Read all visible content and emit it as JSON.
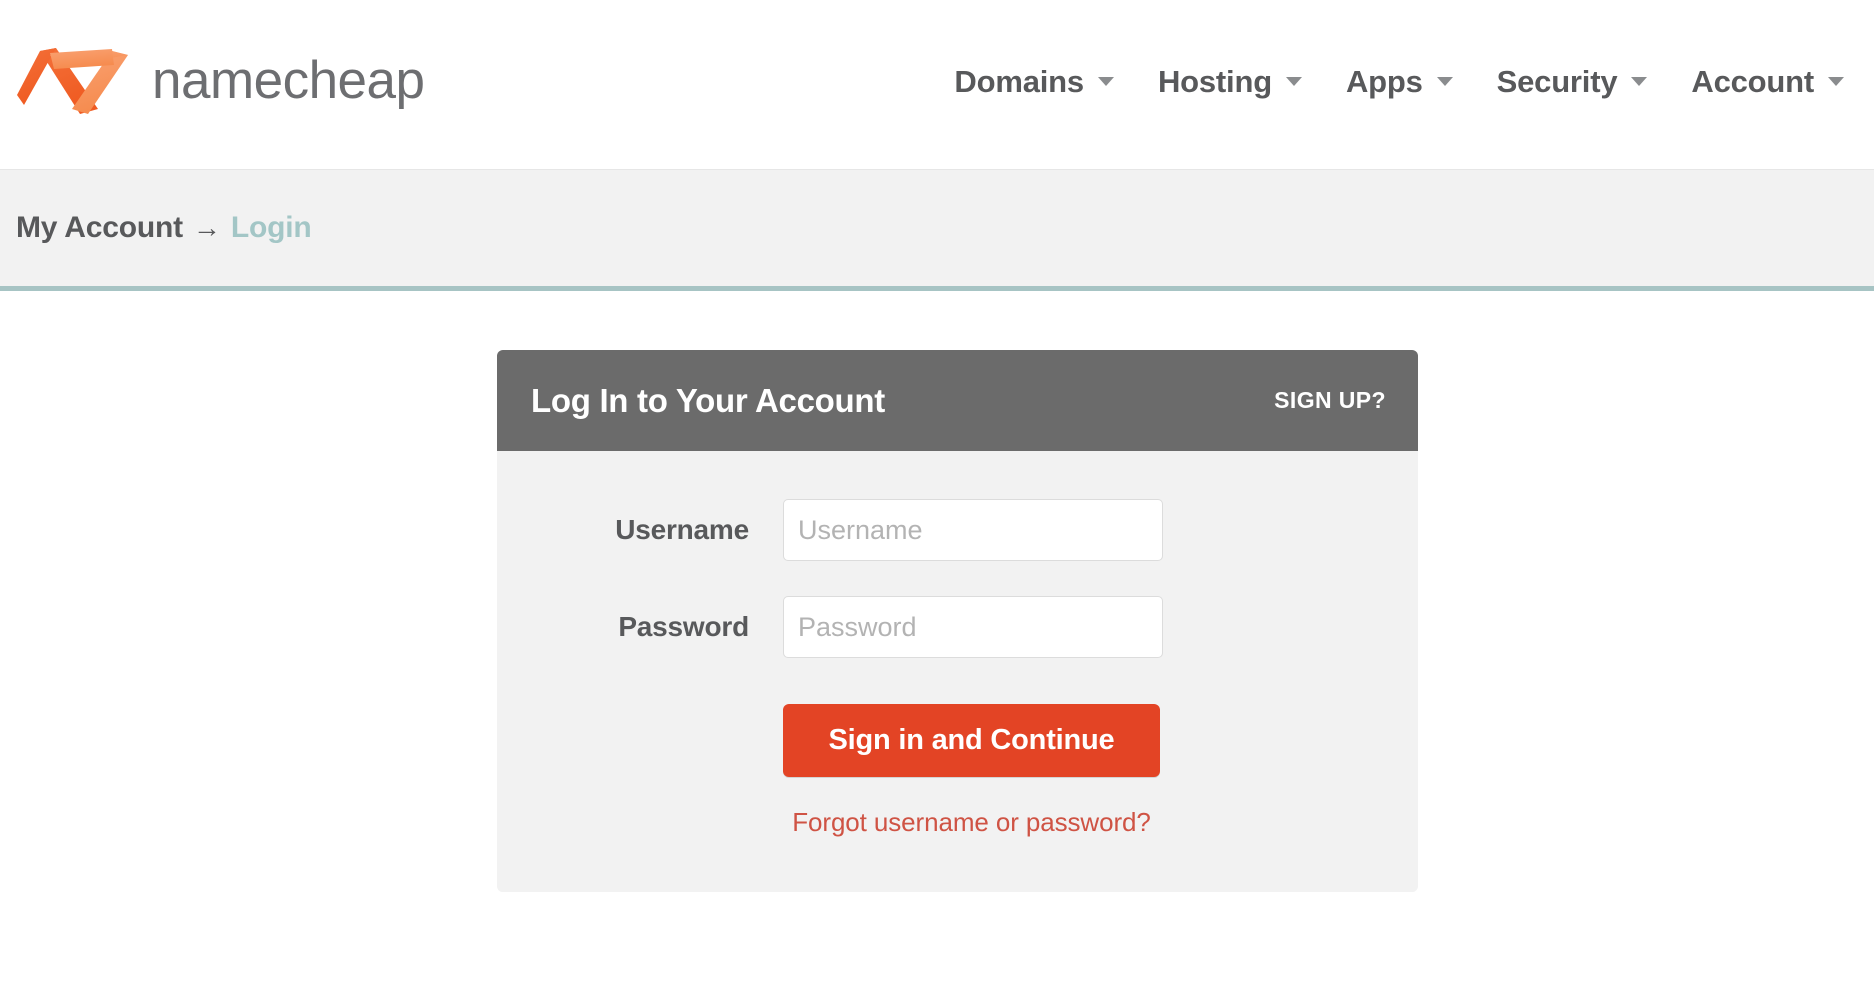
{
  "brand": {
    "name": "namecheap",
    "logo_icon": "namecheap-n-logo",
    "logo_color_dark": "#f05524",
    "logo_color_light": "#f7915b",
    "wordmark_color": "#6d6e71"
  },
  "nav": {
    "items": [
      {
        "label": "Domains",
        "icon": "chevron-down-icon"
      },
      {
        "label": "Hosting",
        "icon": "chevron-down-icon"
      },
      {
        "label": "Apps",
        "icon": "chevron-down-icon"
      },
      {
        "label": "Security",
        "icon": "chevron-down-icon"
      },
      {
        "label": "Account",
        "icon": "chevron-down-icon"
      }
    ]
  },
  "breadcrumb": {
    "root": "My Account",
    "separator": "→",
    "current": "Login",
    "current_color": "#a3c6c6",
    "rule_color": "#a7c4c4"
  },
  "login_card": {
    "title": "Log In to Your Account",
    "signup_label": "SIGN UP?",
    "header_bg": "#6b6b6b",
    "body_bg": "#f2f2f2",
    "fields": [
      {
        "label": "Username",
        "value": "",
        "placeholder": "Username",
        "type": "text"
      },
      {
        "label": "Password",
        "value": "",
        "placeholder": "Password",
        "type": "password"
      }
    ],
    "submit_label": "Sign in and Continue",
    "submit_color": "#e34425",
    "forgot_label": "Forgot username or password?",
    "forgot_color": "#cf5344"
  }
}
